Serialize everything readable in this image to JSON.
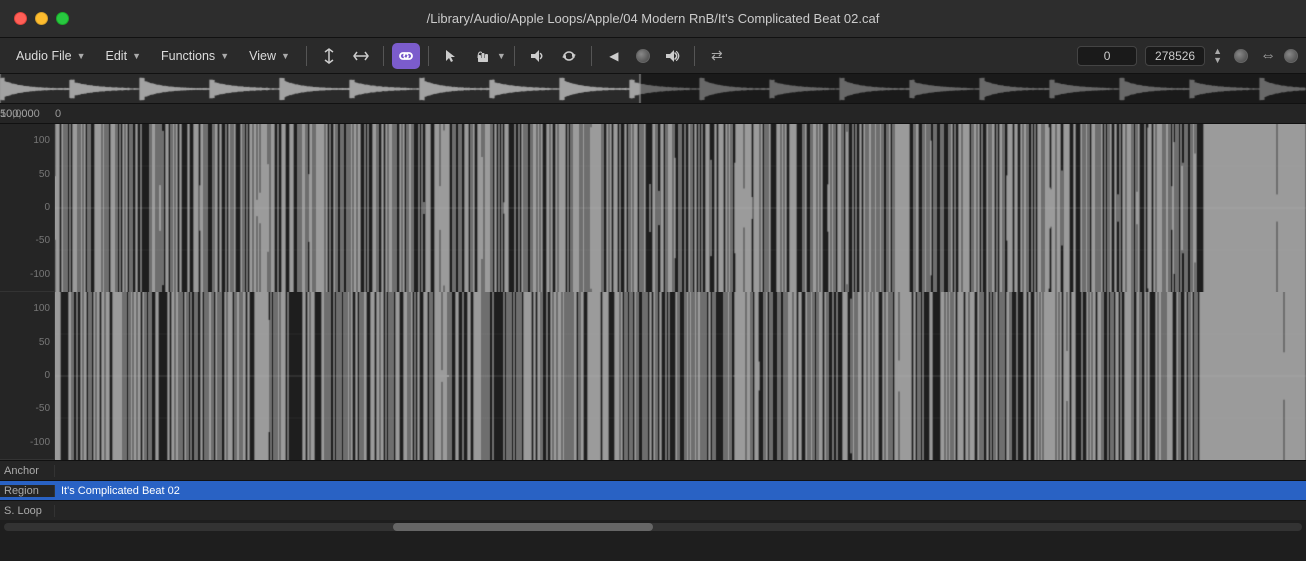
{
  "window": {
    "title": "/Library/Audio/Apple Loops/Apple/04 Modern RnB/It's Complicated Beat 02.caf"
  },
  "controls": {
    "close": "close",
    "minimize": "minimize",
    "maximize": "maximize"
  },
  "toolbar": {
    "menus": [
      {
        "label": "Audio File",
        "id": "audio-file-menu"
      },
      {
        "label": "Edit",
        "id": "edit-menu"
      },
      {
        "label": "Functions",
        "id": "functions-menu"
      },
      {
        "label": "View",
        "id": "view-menu"
      }
    ],
    "position_start": "0",
    "position_end": "278526",
    "zoom_label": "zoom"
  },
  "ruler": {
    "markers": [
      {
        "label": "50,000",
        "position_pct": 37
      },
      {
        "label": "100,000",
        "position_pct": 72
      }
    ]
  },
  "channels": [
    {
      "id": "ch1",
      "labels": [
        "100",
        "50",
        "0",
        "-50",
        "-100"
      ]
    },
    {
      "id": "ch2",
      "labels": [
        "100",
        "50",
        "0",
        "-50",
        "-100"
      ]
    }
  ],
  "metadata": {
    "anchor_label": "Anchor",
    "anchor_value": "",
    "region_label": "Region",
    "region_value": "It's Complicated Beat 02",
    "sloop_label": "S. Loop",
    "sloop_value": ""
  },
  "icons": {
    "split": "⌶",
    "nudge": "⇥",
    "link": "🔗",
    "pointer": "↖",
    "hand": "✋",
    "speaker": "🔈",
    "loop": "🔁",
    "rewind": "◀",
    "stop": "⬛",
    "play": "🔊",
    "forward": "⇄",
    "expand": "⇔"
  },
  "colors": {
    "toolbar_bg": "#2a2a2a",
    "waveform_bg": "#1e1e1e",
    "waveform_color": "#e0e0e0",
    "active_btn": "#7b5ccc",
    "region_highlight": "#2962c4"
  }
}
